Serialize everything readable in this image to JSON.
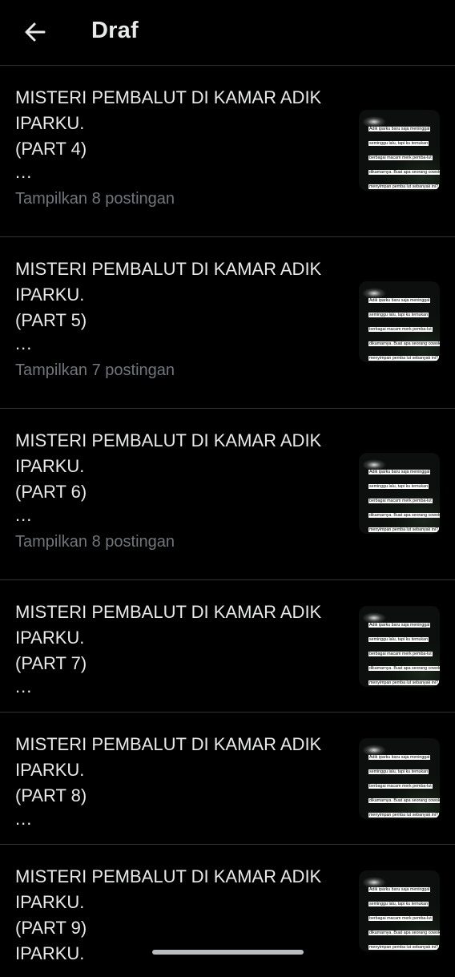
{
  "header": {
    "title": "Draf",
    "back_icon": "arrow-left-icon"
  },
  "thumbnail_caption": "Adik iparku baru saja meninggal seminggu lalu, tapi ku temukan berbagai macam merk pemba-lut dikamarnya. Buat apa seorang cowok menyimpan pemba lut sebanyak ini?",
  "drafts": [
    {
      "line1": "MISTERI PEMBALUT DI KAMAR ADIK",
      "line2": "IPARKU.",
      "line3": "(PART 4)",
      "line4": "...",
      "show_posts": "Tampilkan 8 postingan"
    },
    {
      "line1": "MISTERI PEMBALUT DI KAMAR ADIK",
      "line2": "IPARKU.",
      "line3": "(PART 5)",
      "line4": "...",
      "show_posts": "Tampilkan 7 postingan"
    },
    {
      "line1": "MISTERI PEMBALUT DI KAMAR ADIK",
      "line2": "IPARKU.",
      "line3": "(PART 6)",
      "line4": "...",
      "show_posts": "Tampilkan 8 postingan"
    },
    {
      "line1": "MISTERI PEMBALUT DI KAMAR ADIK",
      "line2": "IPARKU.",
      "line3": "(PART 7)",
      "line4": "..."
    },
    {
      "line1": "MISTERI PEMBALUT DI KAMAR ADIK",
      "line2": "IPARKU.",
      "line3": "(PART 8)",
      "line4": "..."
    },
    {
      "line1": "MISTERI PEMBALUT DI KAMAR ADIK",
      "line2": "IPARKU.",
      "line3": "(PART 9)",
      "line4": "IPARKU."
    }
  ],
  "colors": {
    "background": "#000000",
    "text_primary": "#e7e9ea",
    "text_secondary": "#71767b",
    "divider": "#2f3336"
  }
}
